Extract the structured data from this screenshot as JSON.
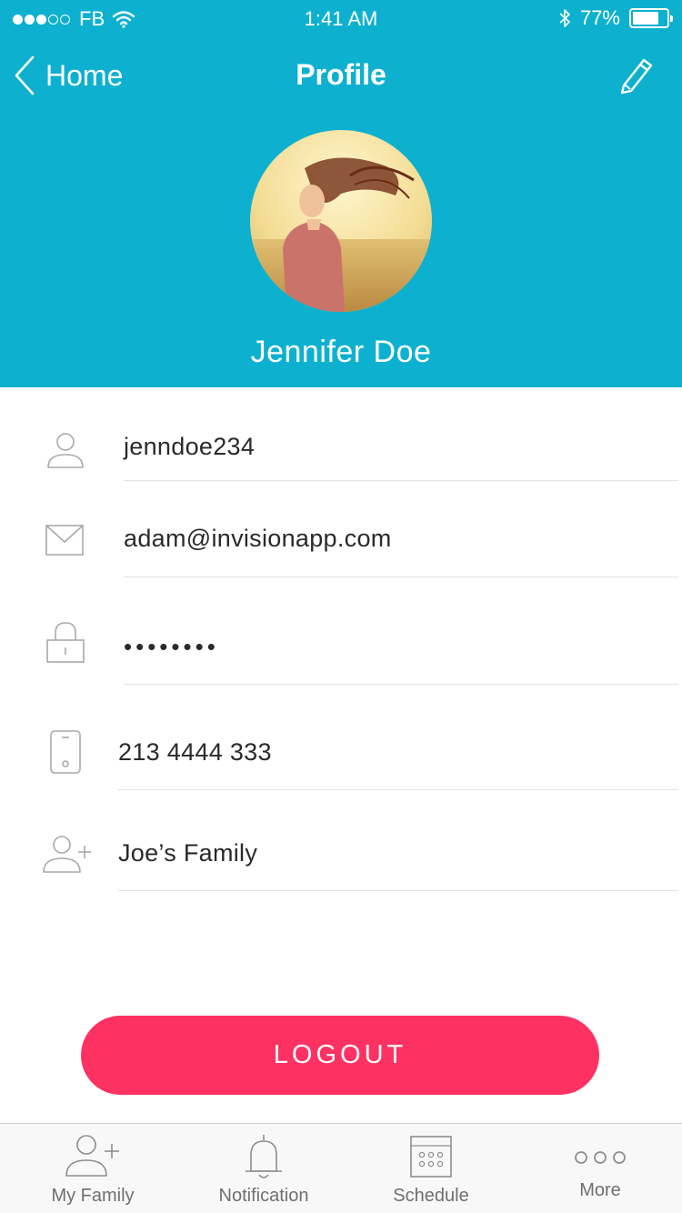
{
  "status_bar": {
    "carrier": "FB",
    "time": "1:41 AM",
    "battery_text": "77%",
    "battery_level": 0.77
  },
  "nav": {
    "back_label": "Home",
    "title": "Profile"
  },
  "profile": {
    "name": "Jennifer Doe"
  },
  "fields": {
    "username": "jenndoe234",
    "email": "adam@invisionapp.com",
    "password": "••••••••",
    "phone": "213 4444 333",
    "family": "Joe’s Family"
  },
  "logout_label": "LOGOUT",
  "tabs": [
    {
      "label": "My Family",
      "icon": "add-user-icon"
    },
    {
      "label": "Notification",
      "icon": "bell-icon"
    },
    {
      "label": "Schedule",
      "icon": "calendar-icon"
    },
    {
      "label": "More",
      "icon": "more-icon"
    }
  ],
  "colors": {
    "header": "#0db1cf",
    "logout": "#fe3163",
    "icon_gray": "#a9a9a9"
  }
}
